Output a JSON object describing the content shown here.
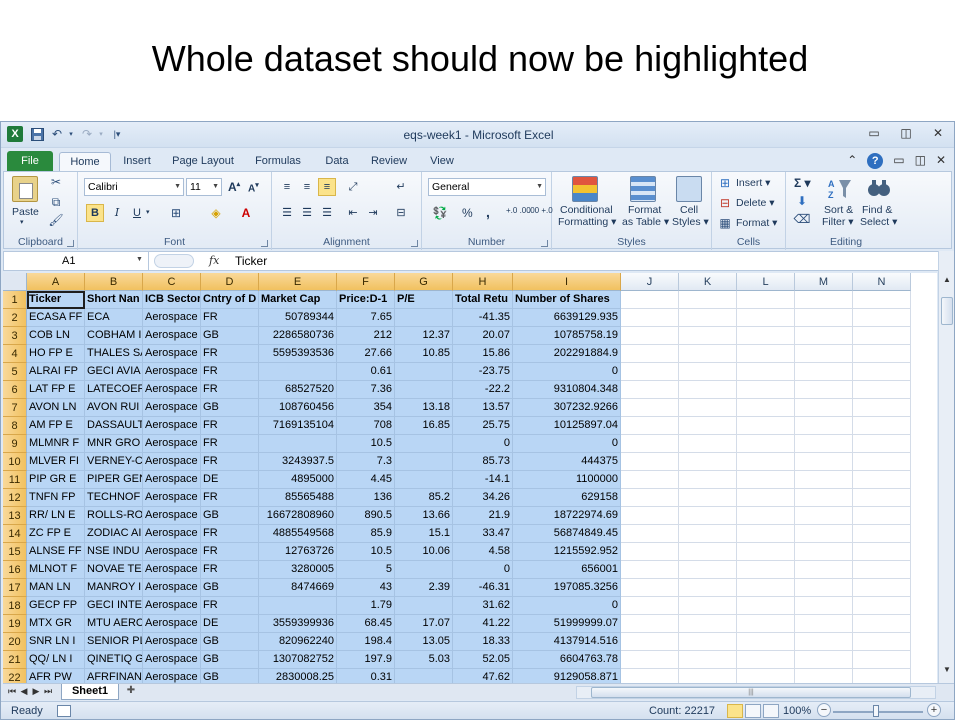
{
  "slide": {
    "title": "Whole dataset should now be highlighted"
  },
  "window": {
    "title": "eqs-week1  -  Microsoft Excel",
    "tabs": [
      "File",
      "Home",
      "Insert",
      "Page Layout",
      "Formulas",
      "Data",
      "Review",
      "View"
    ],
    "active_tab": "Home"
  },
  "ribbon": {
    "clipboard": {
      "label": "Clipboard",
      "paste": "Paste"
    },
    "font": {
      "label": "Font",
      "font_name": "Calibri",
      "font_size": "11",
      "bold": "B",
      "italic": "I",
      "underline": "U"
    },
    "alignment": {
      "label": "Alignment"
    },
    "number": {
      "label": "Number",
      "format": "General",
      "percent": "%",
      "comma": ",",
      "inc_dec": "+.0 .00",
      "dec_dec": ".00 +.0"
    },
    "styles": {
      "label": "Styles",
      "cond_format": [
        "Conditional",
        "Formatting ▾"
      ],
      "format_table": [
        "Format",
        "as Table ▾"
      ],
      "cell_styles": [
        "Cell",
        "Styles ▾"
      ]
    },
    "cells": {
      "label": "Cells",
      "insert": "Insert ▾",
      "delete": "Delete ▾",
      "format": "Format ▾"
    },
    "editing": {
      "label": "Editing",
      "sigma": "Σ ▾",
      "sort_filter": [
        "Sort &",
        "Filter ▾"
      ],
      "find_select": [
        "Find &",
        "Select ▾"
      ]
    }
  },
  "formula_bar": {
    "name_box": "A1",
    "fx": "fx",
    "content": "Ticker"
  },
  "sheet": {
    "columns": [
      "A",
      "B",
      "C",
      "D",
      "E",
      "F",
      "G",
      "H",
      "I",
      "J",
      "K",
      "L",
      "M",
      "N"
    ],
    "row_numbers": [
      "1",
      "2",
      "3",
      "4",
      "5",
      "6",
      "7",
      "8",
      "9",
      "10",
      "11",
      "12",
      "13",
      "14",
      "15",
      "16",
      "17",
      "18",
      "19",
      "20",
      "21",
      "22"
    ],
    "header_row": [
      "Ticker",
      "Short Nan",
      "ICB Sector",
      "Cntry of D",
      "Market Cap",
      "Price:D-1",
      "P/E",
      "Total Retu",
      "Number of Shares"
    ],
    "rows": [
      [
        "ECASA   FF",
        "ECA",
        "Aerospace",
        "FR",
        "50789344",
        "7.65",
        "",
        "-41.35",
        "6639129.935"
      ],
      [
        "COB     LN",
        "COBHAM I",
        "Aerospace",
        "GB",
        "2286580736",
        "212",
        "12.37",
        "20.07",
        "10785758.19"
      ],
      [
        "HO      FP E",
        "THALES SA",
        "Aerospace",
        "FR",
        "5595393536",
        "27.66",
        "10.85",
        "15.86",
        "202291884.9"
      ],
      [
        "ALRAI   FP",
        "GECI AVIA",
        "Aerospace",
        "FR",
        "",
        "0.61",
        "",
        "-23.75",
        "0"
      ],
      [
        "LAT     FP E",
        "LATECOER",
        "Aerospace",
        "FR",
        "68527520",
        "7.36",
        "",
        "-22.2",
        "9310804.348"
      ],
      [
        "AVON    LN",
        "AVON RUI",
        "Aerospace",
        "GB",
        "108760456",
        "354",
        "13.18",
        "13.57",
        "307232.9266"
      ],
      [
        "AM      FP E",
        "DASSAULT",
        "Aerospace",
        "FR",
        "7169135104",
        "708",
        "16.85",
        "25.75",
        "10125897.04"
      ],
      [
        "MLMNR   F",
        "MNR GRO",
        "Aerospace",
        "FR",
        "",
        "10.5",
        "",
        "0",
        "0"
      ],
      [
        "MLVER   FI",
        "VERNEY-C",
        "Aerospace",
        "FR",
        "3243937.5",
        "7.3",
        "",
        "85.73",
        "444375"
      ],
      [
        "PIP     GR E",
        "PIPER GEN",
        "Aerospace",
        "DE",
        "4895000",
        "4.45",
        "",
        "-14.1",
        "1100000"
      ],
      [
        "TNFN    FP",
        "TECHNOF",
        "Aerospace",
        "FR",
        "85565488",
        "136",
        "85.2",
        "34.26",
        "629158"
      ],
      [
        "RR/     LN E",
        "ROLLS-RO",
        "Aerospace",
        "GB",
        "16672808960",
        "890.5",
        "13.66",
        "21.9",
        "18722974.69"
      ],
      [
        "ZC      FP E",
        "ZODIAC AI",
        "Aerospace",
        "FR",
        "4885549568",
        "85.9",
        "15.1",
        "33.47",
        "56874849.45"
      ],
      [
        "ALNSE   FF",
        "NSE INDU",
        "Aerospace",
        "FR",
        "12763726",
        "10.5",
        "10.06",
        "4.58",
        "1215592.952"
      ],
      [
        "MLNOT   F",
        "NOVAE TE",
        "Aerospace",
        "FR",
        "3280005",
        "5",
        "",
        "0",
        "656001"
      ],
      [
        "MAN     LN",
        "MANROY I",
        "Aerospace",
        "GB",
        "8474669",
        "43",
        "2.39",
        "-46.31",
        "197085.3256"
      ],
      [
        "GECP    FP",
        "GECI INTE",
        "Aerospace",
        "FR",
        "",
        "1.79",
        "",
        "31.62",
        "0"
      ],
      [
        "MTX     GR",
        "MTU AERC",
        "Aerospace",
        "DE",
        "3559399936",
        "68.45",
        "17.07",
        "41.22",
        "51999999.07"
      ],
      [
        "SNR     LN I",
        "SENIOR PL",
        "Aerospace",
        "GB",
        "820962240",
        "198.4",
        "13.05",
        "18.33",
        "4137914.516"
      ],
      [
        "QQ/     LN I",
        "QINETIQ G",
        "Aerospace",
        "GB",
        "1307082752",
        "197.9",
        "5.03",
        "52.05",
        "6604763.78"
      ],
      [
        "AFR     PW",
        "AFRFINAN",
        "Aerospace",
        "GB",
        "2830008.25",
        "0.31",
        "",
        "47.62",
        "9129058.871"
      ]
    ],
    "tab_name": "Sheet1"
  },
  "status": {
    "ready": "Ready",
    "count": "Count: 22217",
    "zoom": "100%"
  }
}
